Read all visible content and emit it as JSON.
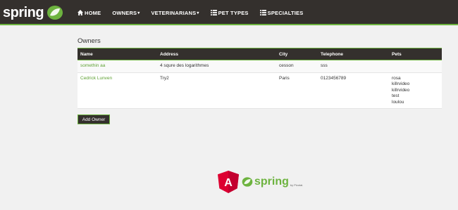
{
  "brand": {
    "name": "spring"
  },
  "nav": {
    "items": [
      {
        "label": "HOME",
        "icon": "home-icon"
      },
      {
        "label": "OWNERS",
        "caret": "▾"
      },
      {
        "label": "VETERINARIANS",
        "caret": "▾"
      },
      {
        "label": "PET TYPES",
        "icon": "list-icon"
      },
      {
        "label": "SPECIALTIES",
        "icon": "list-icon"
      }
    ]
  },
  "page": {
    "title": "Owners"
  },
  "table": {
    "headers": [
      "Name",
      "Address",
      "City",
      "Telephone",
      "Pets"
    ],
    "rows": [
      {
        "name": "somethin aa",
        "address": "4 squre des logarithmes",
        "city": "cesson",
        "telephone": "sss",
        "pets": []
      },
      {
        "name": "Cedrick Lunven",
        "address": "Try2",
        "city": "Paris",
        "telephone": "0123456789",
        "pets": [
          "rosa",
          "killrvideo",
          "killrvideo",
          "test",
          "loulou"
        ]
      }
    ]
  },
  "actions": {
    "add_owner": "Add Owner"
  },
  "footer": {
    "angular_letter": "A",
    "spring_text": "spring",
    "pivotal_text": "by Pivotal."
  },
  "colors": {
    "navbar": "#34302d",
    "accent": "#6db33f",
    "background": "#f1f1f1",
    "angular": "#dd0031"
  }
}
